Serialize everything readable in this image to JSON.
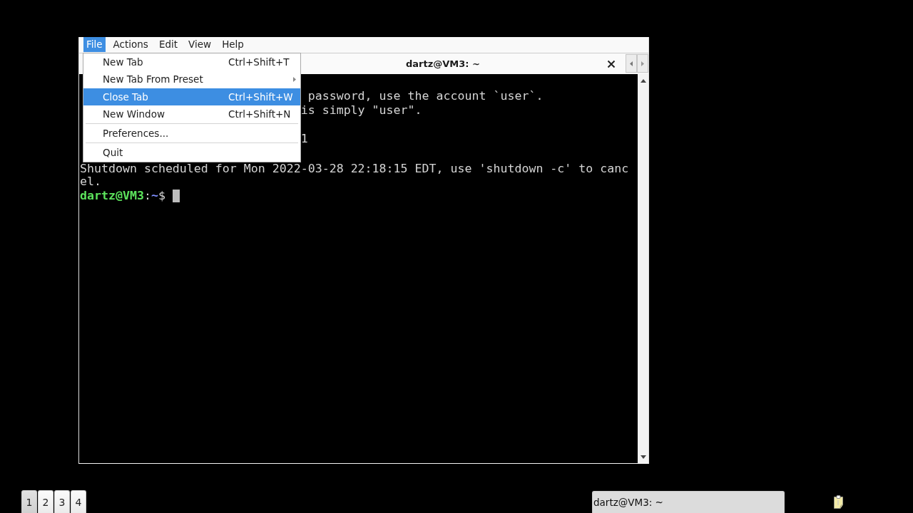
{
  "window": {
    "menubar": [
      {
        "label": "File",
        "selected": true
      },
      {
        "label": "Actions",
        "selected": false
      },
      {
        "label": "Edit",
        "selected": false
      },
      {
        "label": "View",
        "selected": false
      },
      {
        "label": "Help",
        "selected": false
      }
    ],
    "menu": {
      "sections": [
        {
          "items": [
            {
              "kind": "command",
              "label": "New Tab",
              "shortcut": "Ctrl+Shift+T",
              "selected": false
            },
            {
              "kind": "submenu",
              "label": "New Tab From Preset",
              "selected": false
            },
            {
              "kind": "command",
              "label": "Close Tab",
              "shortcut": "Ctrl+Shift+W",
              "selected": true
            },
            {
              "kind": "command",
              "label": "New Window",
              "shortcut": "Ctrl+Shift+N",
              "selected": false
            }
          ]
        },
        {
          "items": [
            {
              "kind": "command",
              "label": "Preferences...",
              "selected": false
            }
          ]
        },
        {
          "items": [
            {
              "kind": "command",
              "label": "Quit",
              "selected": false
            }
          ]
        }
      ]
    },
    "tabs": [
      {
        "title": "dartz@VM3: ~",
        "selected": true
      }
    ],
    "terminal": {
      "lines": [
        "password, use the account `user`.",
        "is simply \"user\".",
        "1",
        "Shutdown scheduled for Mon 2022-03-28 22:18:15 EDT, use 'shutdown -c' to cancel."
      ],
      "prompt": [
        {
          "kind": "user",
          "text": "dartz@VM3"
        },
        {
          "kind": "plain",
          "text": ":"
        },
        {
          "kind": "path",
          "text": "~"
        },
        {
          "kind": "plain",
          "text": "$"
        }
      ],
      "cursor": true
    }
  },
  "panel": {
    "desktops": [
      {
        "label": "1",
        "selected": true
      },
      {
        "label": "2",
        "selected": false
      },
      {
        "label": "3",
        "selected": false
      },
      {
        "label": "4",
        "selected": false
      }
    ],
    "tasks": [
      {
        "title": "dartz@VM3: ~"
      }
    ]
  }
}
